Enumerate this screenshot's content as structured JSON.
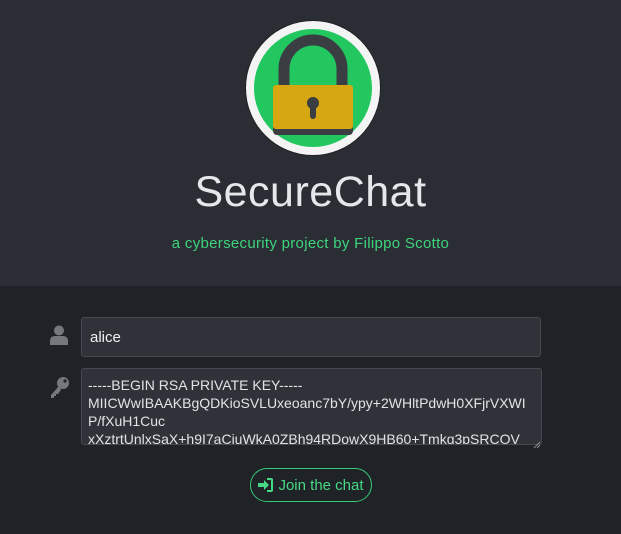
{
  "header": {
    "logo_icon": "padlock-icon",
    "title": "SecureChat",
    "subtitle": "a cybersecurity project by Filippo Scotto"
  },
  "form": {
    "username_icon": "user-icon",
    "username_value": "alice",
    "key_icon": "key-icon",
    "private_key_value": "-----BEGIN RSA PRIVATE KEY-----\nMIICWwIBAAKBgQDKioSVLUxeoanc7bY/ypy+2WHltPdwH0XFjrVXWIP/fXuH1Cuc\nxXztrtUnlxSaX+h9I7aCjuWkA0ZBh94RDowX9HB60+Tmkg3pSRCOV",
    "join_button_icon": "sign-in-icon",
    "join_button_label": "Join the chat"
  },
  "colors": {
    "background": "#1f2227",
    "header_background": "#2a2d33",
    "accent": "#3ed47e",
    "logo_green": "#22c85f",
    "lock_gold": "#d6a710"
  }
}
